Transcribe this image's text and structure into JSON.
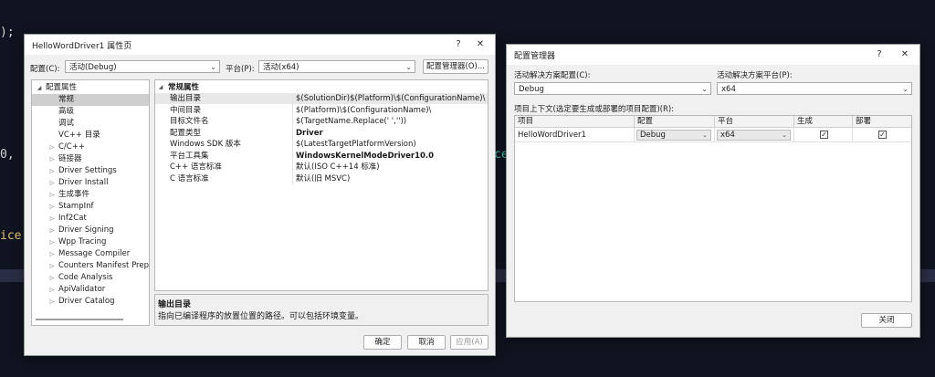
{
  "background": {
    "fragments": [
      ");",
      "0,",
      "ice",
      "ce"
    ]
  },
  "property_dialog": {
    "title": "HelloWordDriver1 属性页",
    "help_label": "?",
    "close_label": "✕",
    "config_label": "配置(C):",
    "config_value": "活动(Debug)",
    "platform_label": "平台(P):",
    "platform_value": "活动(x64)",
    "config_manager_button": "配置管理器(O)...",
    "tree": [
      {
        "label": "配置属性",
        "expander": "◢",
        "indent": 0,
        "selected": false
      },
      {
        "label": "常规",
        "expander": "",
        "indent": 1,
        "selected": true
      },
      {
        "label": "高级",
        "expander": "",
        "indent": 1,
        "selected": false
      },
      {
        "label": "调试",
        "expander": "",
        "indent": 1,
        "selected": false
      },
      {
        "label": "VC++ 目录",
        "expander": "",
        "indent": 1,
        "selected": false
      },
      {
        "label": "C/C++",
        "expander": "▷",
        "indent": 1,
        "selected": false
      },
      {
        "label": "链接器",
        "expander": "▷",
        "indent": 1,
        "selected": false
      },
      {
        "label": "Driver Settings",
        "expander": "▷",
        "indent": 1,
        "selected": false
      },
      {
        "label": "Driver Install",
        "expander": "▷",
        "indent": 1,
        "selected": false
      },
      {
        "label": "生成事件",
        "expander": "▷",
        "indent": 1,
        "selected": false
      },
      {
        "label": "StampInf",
        "expander": "▷",
        "indent": 1,
        "selected": false
      },
      {
        "label": "Inf2Cat",
        "expander": "▷",
        "indent": 1,
        "selected": false
      },
      {
        "label": "Driver Signing",
        "expander": "▷",
        "indent": 1,
        "selected": false
      },
      {
        "label": "Wpp Tracing",
        "expander": "▷",
        "indent": 1,
        "selected": false
      },
      {
        "label": "Message Compiler",
        "expander": "▷",
        "indent": 1,
        "selected": false
      },
      {
        "label": "Counters Manifest Preproc",
        "expander": "▷",
        "indent": 1,
        "selected": false
      },
      {
        "label": "Code Analysis",
        "expander": "▷",
        "indent": 1,
        "selected": false
      },
      {
        "label": "ApiValidator",
        "expander": "▷",
        "indent": 1,
        "selected": false
      },
      {
        "label": "Driver Catalog",
        "expander": "▷",
        "indent": 1,
        "selected": false
      }
    ],
    "section_title": "常规属性",
    "section_expander": "◢",
    "properties": [
      {
        "name": "输出目录",
        "value": "$(SolutionDir)$(Platform)\\$(ConfigurationName)\\",
        "bold": false
      },
      {
        "name": "中间目录",
        "value": "$(Platform)\\$(ConfigurationName)\\",
        "bold": false
      },
      {
        "name": "目标文件名",
        "value": "$(TargetName.Replace(' ',''))",
        "bold": false
      },
      {
        "name": "配置类型",
        "value": "Driver",
        "bold": true
      },
      {
        "name": "Windows SDK 版本",
        "value": "$(LatestTargetPlatformVersion)",
        "bold": false
      },
      {
        "name": "平台工具集",
        "value": "WindowsKernelModeDriver10.0",
        "bold": true
      },
      {
        "name": "C++ 语言标准",
        "value": "默认(ISO C++14 标准)",
        "bold": false
      },
      {
        "name": "C 语言标准",
        "value": "默认(旧 MSVC)",
        "bold": false
      }
    ],
    "description_title": "输出目录",
    "description_text": "指向已编译程序的放置位置的路径。可以包括环境变量。",
    "ok_button": "确定",
    "cancel_button": "取消",
    "apply_button": "应用(A)"
  },
  "config_manager": {
    "title": "配置管理器",
    "help_label": "?",
    "close_label": "✕",
    "active_config_label": "活动解决方案配置(C):",
    "active_config_value": "Debug",
    "active_platform_label": "活动解决方案平台(P):",
    "active_platform_value": "x64",
    "contexts_label": "项目上下文(选定要生成或部署的项目配置)(R):",
    "columns": [
      "项目",
      "配置",
      "平台",
      "生成",
      "部署"
    ],
    "rows": [
      {
        "project": "HelloWordDriver1",
        "config": "Debug",
        "platform": "x64",
        "build": true,
        "deploy": true
      }
    ],
    "check_glyph": "✓",
    "dropdown_glyph": "⌄",
    "close_button": "关闭"
  }
}
